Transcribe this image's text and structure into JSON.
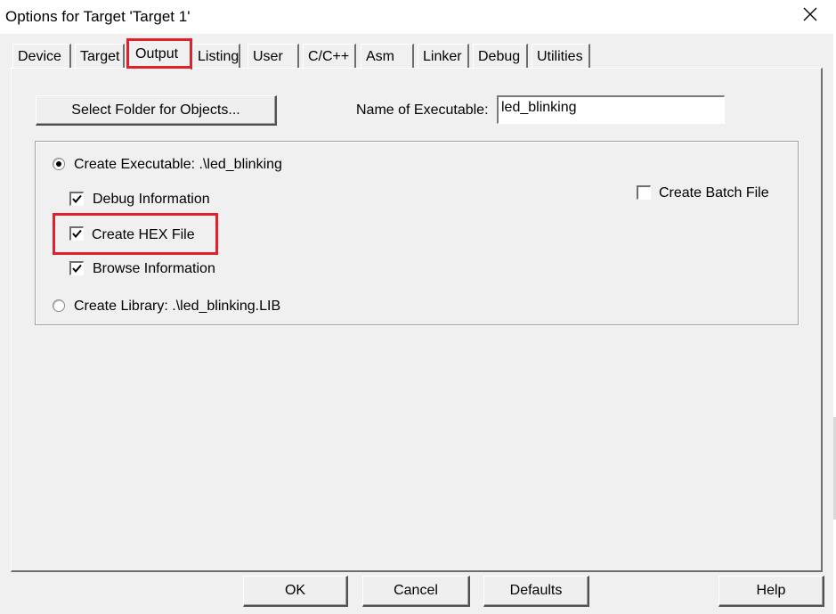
{
  "window": {
    "title": "Options for Target 'Target 1'",
    "close_icon": "close-icon"
  },
  "tabs": [
    {
      "label": "Device",
      "active": false
    },
    {
      "label": "Target",
      "active": false
    },
    {
      "label": "Output",
      "active": true
    },
    {
      "label": "Listing",
      "active": false
    },
    {
      "label": "User",
      "active": false
    },
    {
      "label": "C/C++",
      "active": false
    },
    {
      "label": "Asm",
      "active": false
    },
    {
      "label": "Linker",
      "active": false
    },
    {
      "label": "Debug",
      "active": false
    },
    {
      "label": "Utilities",
      "active": false
    }
  ],
  "output": {
    "select_folder_label": "Select Folder for Objects...",
    "name_of_executable_label": "Name of Executable:",
    "name_of_executable_value": "led_blinking",
    "create_executable_label": "Create Executable:  .\\led_blinking",
    "create_executable_selected": true,
    "debug_information_label": "Debug Information",
    "debug_information_checked": true,
    "create_hex_label": "Create HEX File",
    "create_hex_checked": true,
    "browse_information_label": "Browse Information",
    "browse_information_checked": true,
    "create_library_label": "Create Library:  .\\led_blinking.LIB",
    "create_library_selected": false,
    "create_batch_label": "Create Batch File",
    "create_batch_checked": false
  },
  "footer": {
    "ok_label": "OK",
    "cancel_label": "Cancel",
    "defaults_label": "Defaults",
    "help_label": "Help"
  },
  "colors": {
    "highlight": "#e0202a",
    "dialog_bg": "#f0f0f0"
  }
}
